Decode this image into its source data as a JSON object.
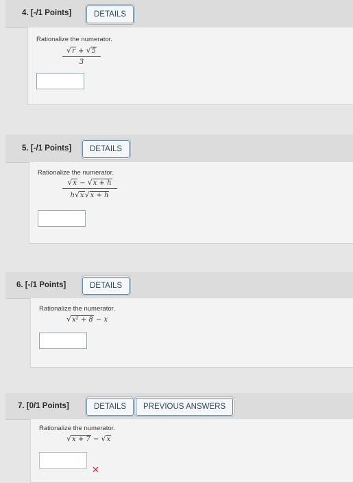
{
  "problems": [
    {
      "title": "4. [-/1 Points]",
      "details": "DETAILS",
      "prompt": "Rationalize the numerator.",
      "expr_num_a": "r",
      "expr_num_op": " + ",
      "expr_num_b": "5",
      "expr_den": "3"
    },
    {
      "title": "5. [-/1 Points]",
      "details": "DETAILS",
      "prompt": "Rationalize the numerator.",
      "expr_num_a": "x",
      "expr_num_op": " − ",
      "expr_num_b": "x + h",
      "expr_den_pre": "h",
      "expr_den_a": "x",
      "expr_den_b": "x + h"
    },
    {
      "title": "6. [-/1 Points]",
      "details": "DETAILS",
      "prompt": "Rationalize the numerator.",
      "expr_rad": "x² + 8",
      "expr_tail": " − x"
    },
    {
      "title": "7. [0/1 Points]",
      "details": "DETAILS",
      "previous": "PREVIOUS ANSWERS",
      "prompt": "Rationalize the numerator.",
      "expr_rad_a": "x + 7",
      "expr_op": " − ",
      "expr_rad_b": "x",
      "status_mark": "✕"
    }
  ],
  "colors": {
    "wrong": "#d0312d",
    "button_text": "#2f4a63"
  }
}
